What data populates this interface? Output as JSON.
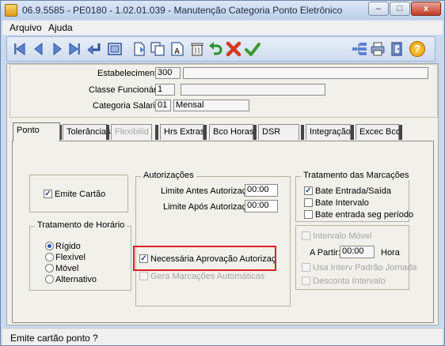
{
  "window": {
    "title": "06.9.5585 - PE0180 - 1.02.01.039 - Manutenção Categoria Ponto Eletrônico",
    "minimize_glyph": "–",
    "maximize_glyph": "□",
    "close_glyph": "x"
  },
  "menu": [
    "Arquivo",
    "Ajuda"
  ],
  "toolbar": {
    "icons": [
      "first-icon",
      "prev-icon",
      "next-icon",
      "last-icon",
      "goto-icon",
      "zoom-icon",
      "new-icon",
      "copy-icon",
      "text-icon",
      "delete-icon",
      "undo-icon",
      "cancel-icon",
      "ok-icon",
      "tree-icon",
      "print-icon",
      "exit-icon",
      "help-icon"
    ],
    "help_glyph": "?"
  },
  "header": {
    "estabelecimento_label": "Estabelecimento:",
    "estabelecimento_value": "300",
    "classe_label": "Classe Funcionário:",
    "classe_value": "1",
    "categoria_label": "Categoria Salarial:",
    "categoria_value": "01",
    "categoria_desc": "Mensal"
  },
  "tabs": [
    "Ponto",
    "Tolerâncias",
    "Flexibilid",
    "Hrs Extras",
    "Bco Horas",
    "DSR",
    "Integração",
    "Excec Bco"
  ],
  "ponto": {
    "emite_cartao": "Emite Cartão",
    "tratamento_horario": {
      "title": "Tratamento de Horário",
      "options": [
        "Rígido",
        "Flexível",
        "Móvel",
        "Alternativo"
      ]
    },
    "autorizacoes": {
      "title": "Autorizações",
      "limite_antes_label": "Limite Antes Autorização:",
      "limite_antes_value": "00:00",
      "limite_apos_label": "Limite Após Autorização:",
      "limite_apos_value": "00:00",
      "necessaria": "Necessária Aprovação Autorizaç",
      "gera_marcacoes": "Gera Marcações Automáticas"
    },
    "tratamento_marcacoes": {
      "title": "Tratamento das Marcações",
      "bate_entrada_saida": "Bate Entrada/Saída",
      "bate_intervalo": "Bate Intervalo",
      "bate_entrada_seg": "Bate entrada seg período"
    },
    "intervalo": {
      "intervalo_movel": "Intervalo Móvel",
      "a_partir_label": "A Partir:",
      "a_partir_value": "00:00",
      "hora": "Hora",
      "usa_interv": "Usa Interv Padrão Jornada",
      "desconta": "Desconta Intervalo"
    }
  },
  "check_glyph": "✓",
  "status": {
    "text": "Emite cartão ponto ?"
  },
  "colors": {
    "highlight": "#e02020",
    "accent": "#2a55b8"
  }
}
